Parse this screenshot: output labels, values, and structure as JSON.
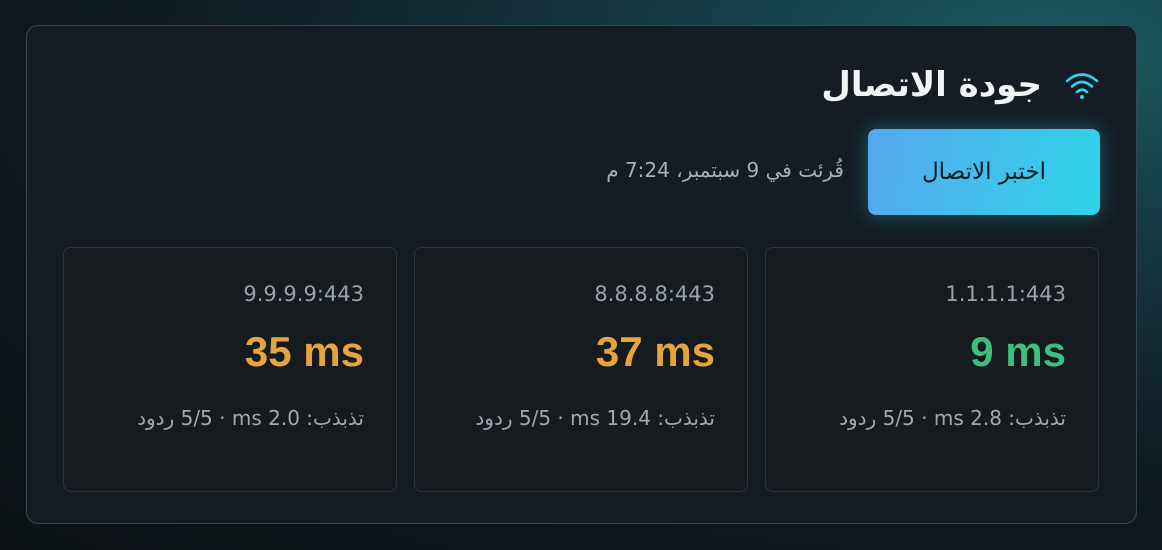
{
  "header": {
    "title": "جودة الاتصال",
    "icon": "wifi-icon"
  },
  "toolbar": {
    "test_button_label": "اختبر الاتصال",
    "timestamp": "قُرئت في 9 سبتمبر، 7:24 م"
  },
  "colors": {
    "good": "#3fbf7f",
    "warn": "#e6a43c",
    "accent": "#2fd3ea"
  },
  "results": [
    {
      "host": "1.1.1.1:443",
      "latency": "9 ms",
      "status": "good",
      "stats_prefix": "تذبذب:",
      "jitter": "2.8 ms",
      "responses": "5/5",
      "responses_label": "ردود"
    },
    {
      "host": "8.8.8.8:443",
      "latency": "37 ms",
      "status": "warn",
      "stats_prefix": "تذبذب:",
      "jitter": "19.4 ms",
      "responses": "5/5",
      "responses_label": "ردود"
    },
    {
      "host": "9.9.9.9:443",
      "latency": "35 ms",
      "status": "warn",
      "stats_prefix": "تذبذب:",
      "jitter": "2.0 ms",
      "responses": "5/5",
      "responses_label": "ردود"
    }
  ]
}
